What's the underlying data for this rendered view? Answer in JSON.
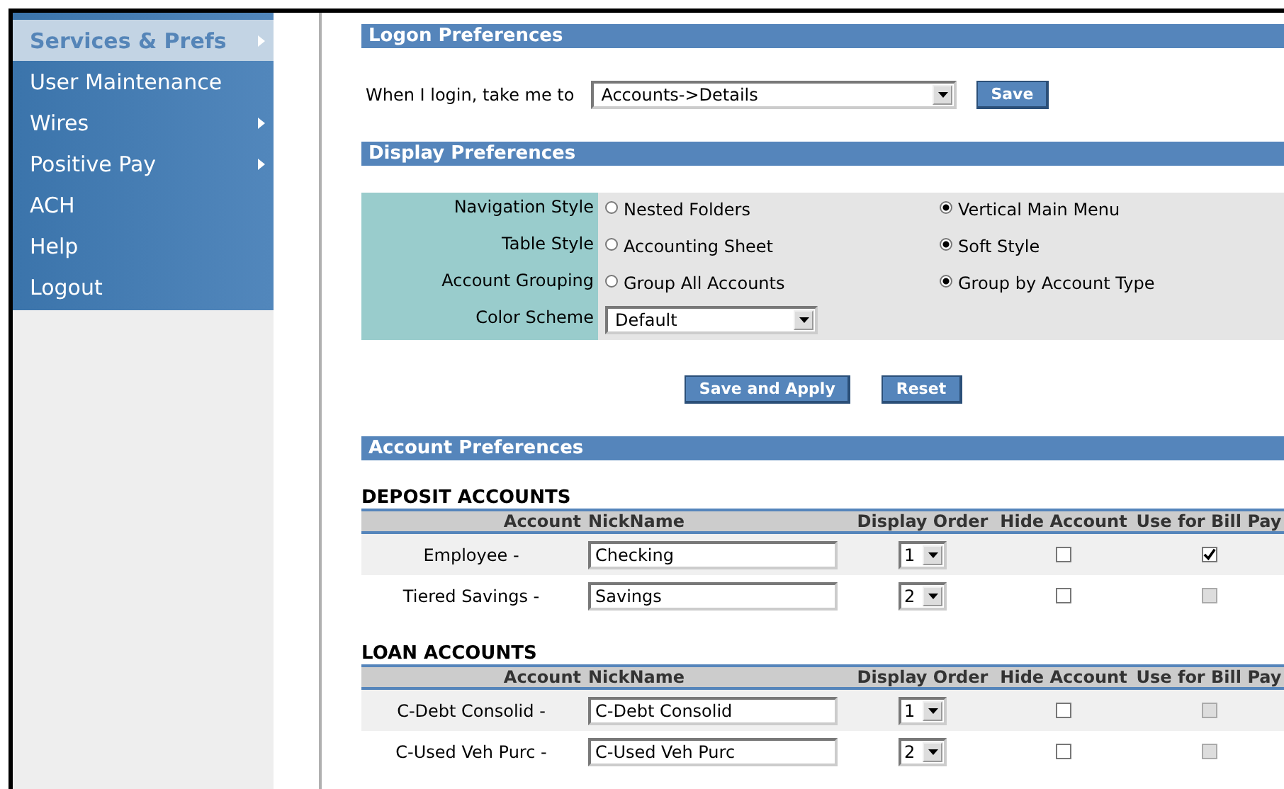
{
  "sidebar": {
    "items": [
      {
        "label": "Services & Prefs",
        "selected": true,
        "submenu": true
      },
      {
        "label": "User Maintenance",
        "selected": false,
        "submenu": false
      },
      {
        "label": "Wires",
        "selected": false,
        "submenu": true
      },
      {
        "label": "Positive Pay",
        "selected": false,
        "submenu": true
      },
      {
        "label": "ACH",
        "selected": false,
        "submenu": false
      },
      {
        "label": "Help",
        "selected": false,
        "submenu": false
      },
      {
        "label": "Logout",
        "selected": false,
        "submenu": false
      }
    ]
  },
  "logon": {
    "title": "Logon Preferences",
    "label": "When I login, take me to",
    "value": "Accounts->Details",
    "button": "Save"
  },
  "display": {
    "title": "Display Preferences",
    "rows": [
      {
        "label": "Navigation Style",
        "kind": "radio",
        "options": [
          {
            "label": "Nested Folders",
            "selected": false
          },
          {
            "label": "Vertical Main Menu",
            "selected": true
          }
        ]
      },
      {
        "label": "Table Style",
        "kind": "radio",
        "options": [
          {
            "label": "Accounting Sheet",
            "selected": false
          },
          {
            "label": "Soft Style",
            "selected": true
          }
        ]
      },
      {
        "label": "Account Grouping",
        "kind": "radio",
        "options": [
          {
            "label": "Group All Accounts",
            "selected": false
          },
          {
            "label": "Group by Account Type",
            "selected": true
          }
        ]
      },
      {
        "label": "Color Scheme",
        "kind": "select",
        "value": "Default"
      }
    ],
    "buttons": [
      "Save and Apply",
      "Reset"
    ]
  },
  "accounts": {
    "title": "Account Preferences",
    "groups": [
      {
        "title": "DEPOSIT ACCOUNTS",
        "columns": [
          "Account",
          "NickName",
          "Display Order",
          "Hide Account",
          "Use for Bill Pay"
        ],
        "rows": [
          {
            "account": "Employee -",
            "nickname": "Checking",
            "order": "1",
            "hide": false,
            "bill_pay": true,
            "bill_pay_disabled": false
          },
          {
            "account": "Tiered Savings -",
            "nickname": "Savings",
            "order": "2",
            "hide": false,
            "bill_pay": false,
            "bill_pay_disabled": true
          }
        ]
      },
      {
        "title": "LOAN ACCOUNTS",
        "columns": [
          "Account",
          "NickName",
          "Display Order",
          "Hide Account",
          "Use for Bill Pay"
        ],
        "rows": [
          {
            "account": "C-Debt Consolid -",
            "nickname": "C-Debt Consolid",
            "order": "1",
            "hide": false,
            "bill_pay": false,
            "bill_pay_disabled": true
          },
          {
            "account": "C-Used Veh Purc -",
            "nickname": "C-Used Veh Purc",
            "order": "2",
            "hide": false,
            "bill_pay": false,
            "bill_pay_disabled": true
          }
        ]
      }
    ]
  }
}
